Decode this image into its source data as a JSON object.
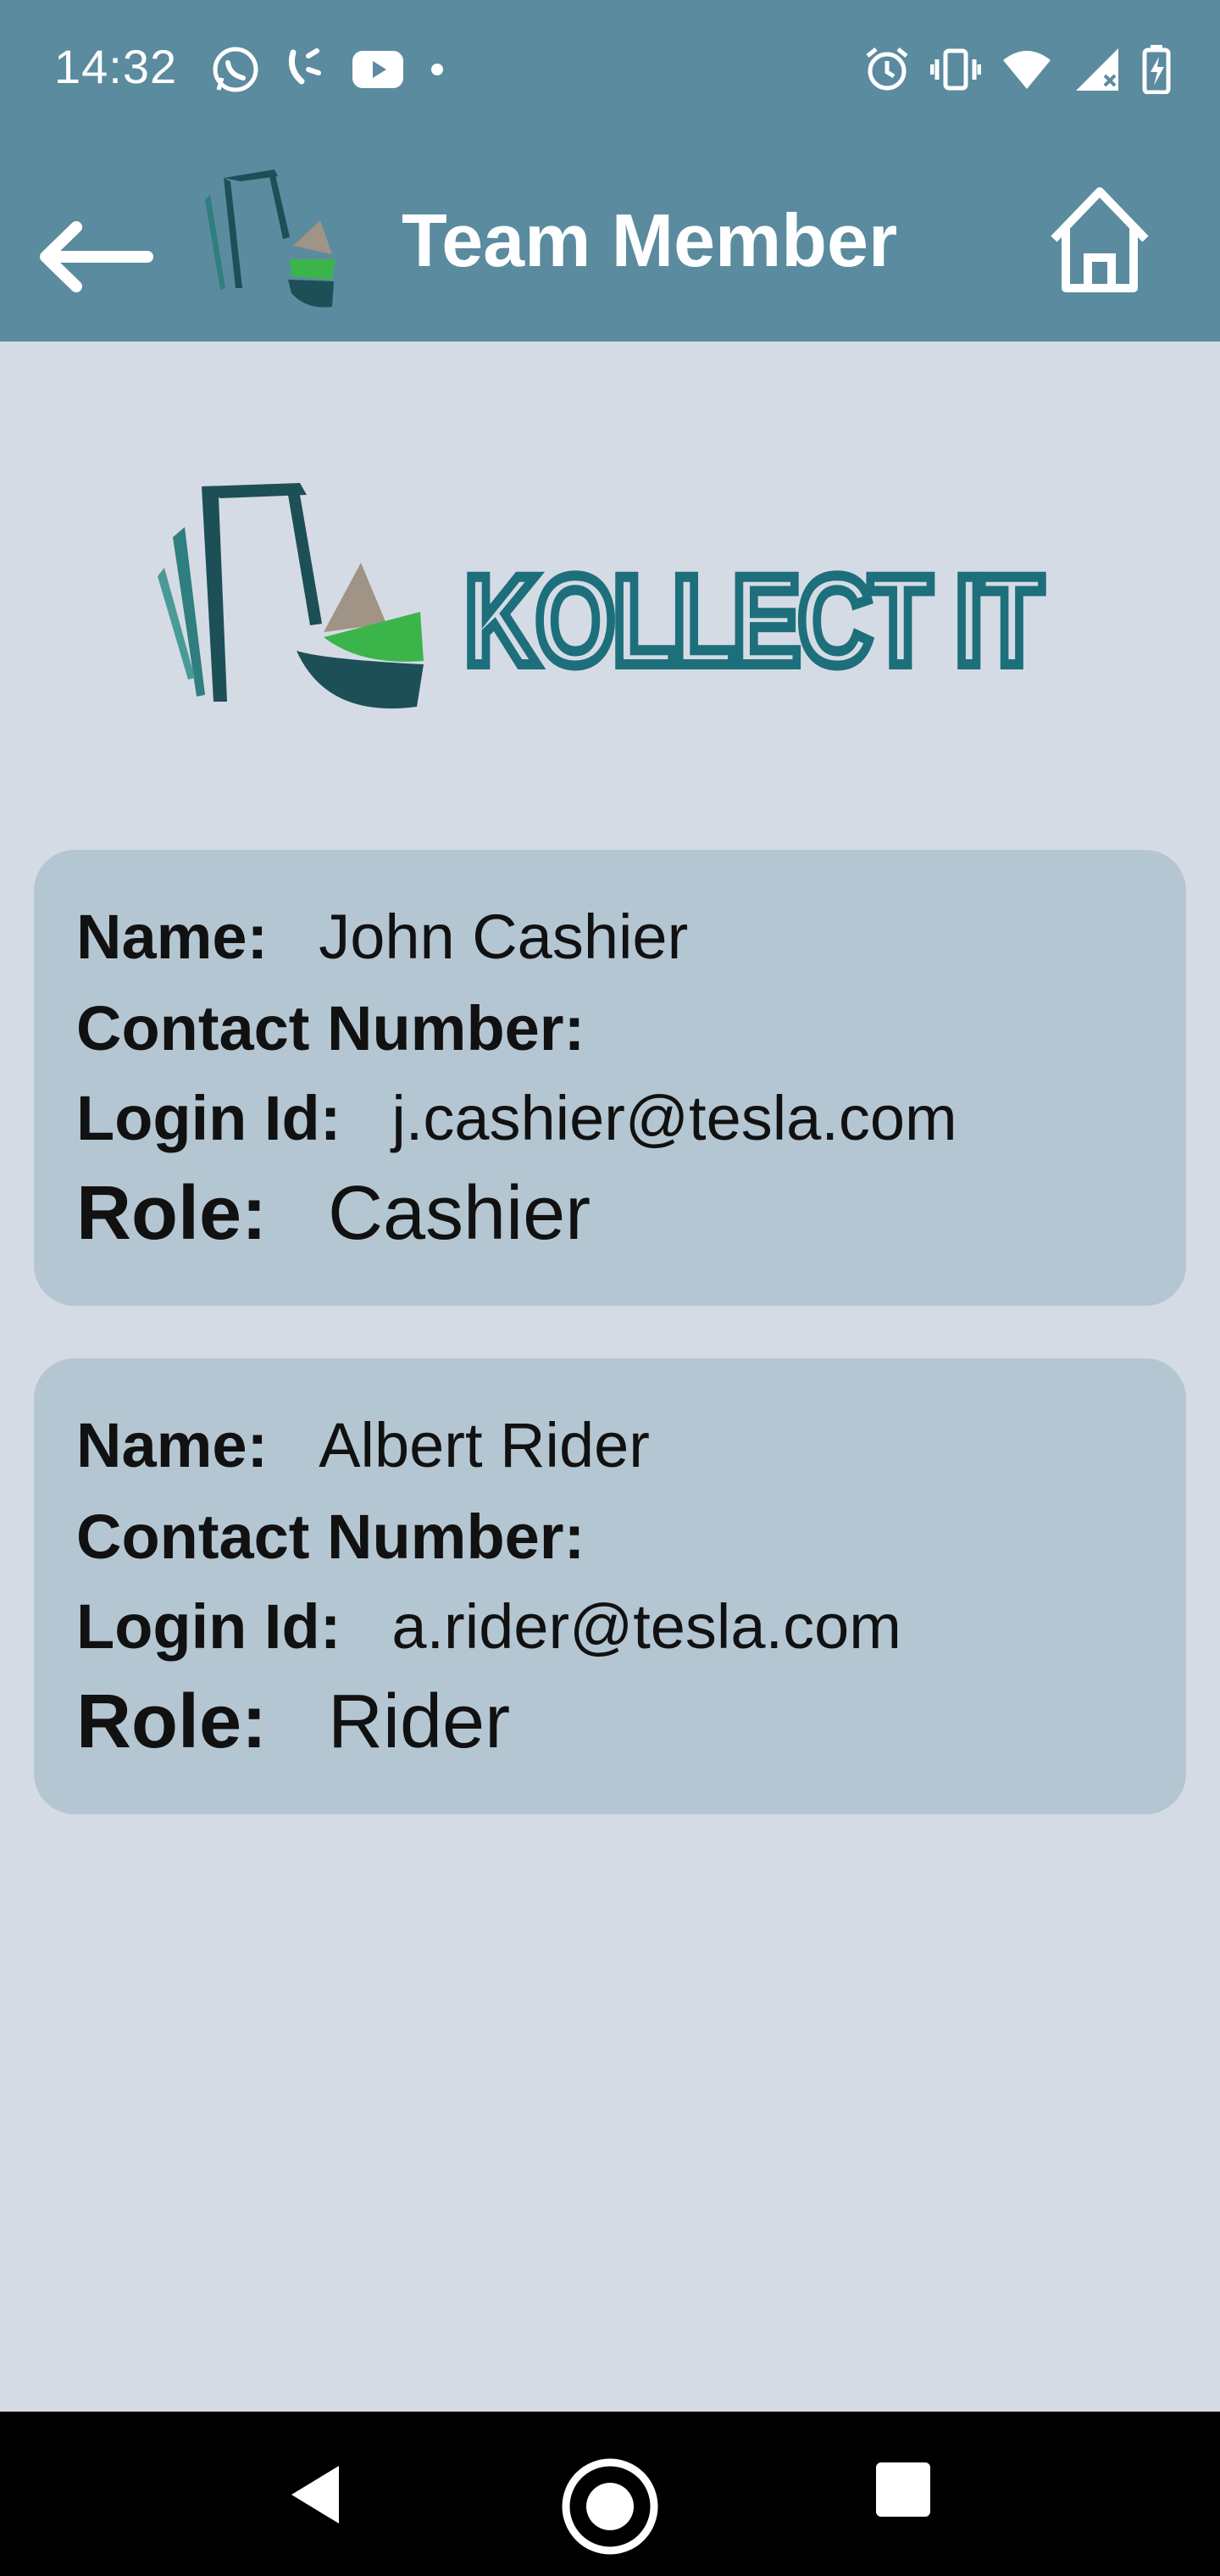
{
  "status_bar": {
    "time": "14:32",
    "left_icons": [
      "whatsapp-icon",
      "missed-call-icon",
      "youtube-icon",
      "dot-icon"
    ],
    "right_icons": [
      "alarm-icon",
      "vibrate-icon",
      "wifi-icon",
      "signal-icon",
      "battery-charging-icon"
    ]
  },
  "app_bar": {
    "title": "Team Member",
    "back_icon": "arrow-left-icon",
    "home_icon": "home-icon",
    "background_color": "#5a8b9f"
  },
  "brand": {
    "name": "KOLLECT IT",
    "primary_color": "#1d6f7b"
  },
  "labels": {
    "name": "Name:",
    "contact": "Contact Number:",
    "login": "Login Id:",
    "role": "Role:"
  },
  "members": [
    {
      "name": "John Cashier",
      "contact": "",
      "login": "j.cashier@tesla.com",
      "role": "Cashier"
    },
    {
      "name": "Albert Rider",
      "contact": "",
      "login": "a.rider@tesla.com",
      "role": "Rider"
    }
  ],
  "nav_bar": {
    "icons": [
      "nav-back-icon",
      "nav-home-icon",
      "nav-recents-icon"
    ]
  }
}
